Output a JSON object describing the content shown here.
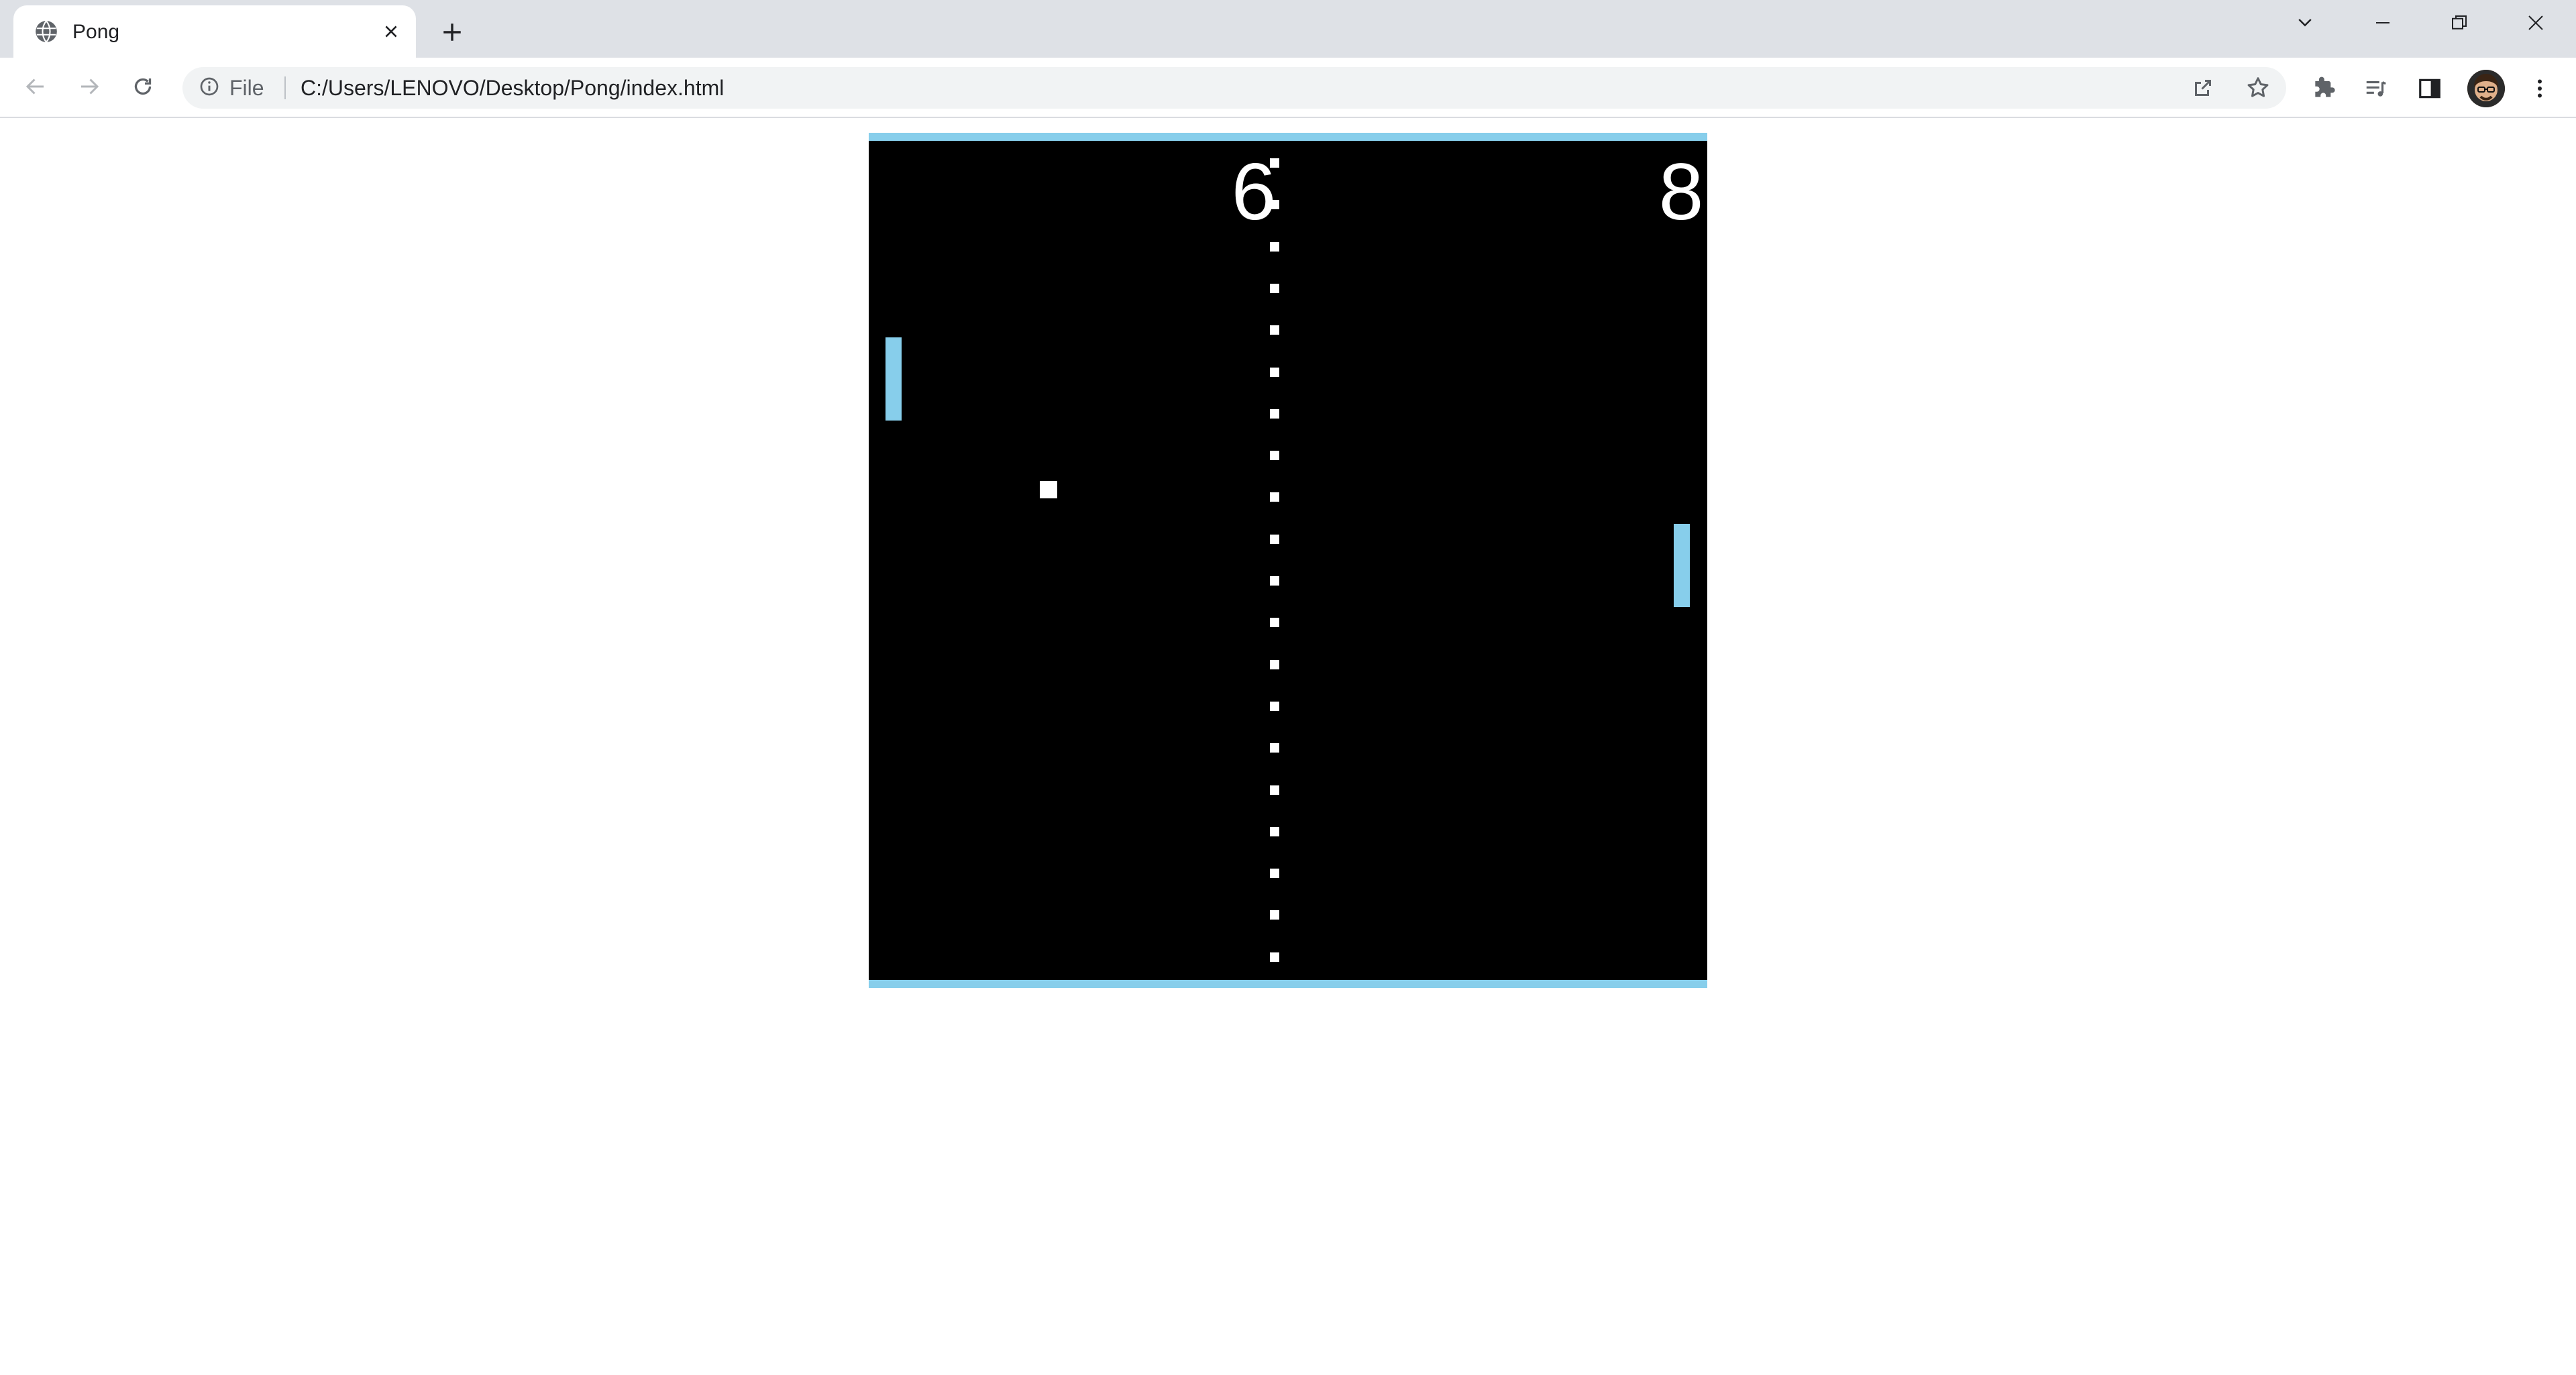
{
  "browser": {
    "tab": {
      "title": "Pong",
      "favicon": "globe-icon"
    },
    "address": {
      "site_info_label": "File",
      "url": "C:/Users/LENOVO/Desktop/Pong/index.html"
    }
  },
  "game": {
    "score_left": "6",
    "score_right": "8",
    "colors": {
      "court": "#000000",
      "walls": "#87ceeb",
      "paddles": "#87ceeb",
      "ball": "#ffffff",
      "net": "#ffffff"
    }
  }
}
